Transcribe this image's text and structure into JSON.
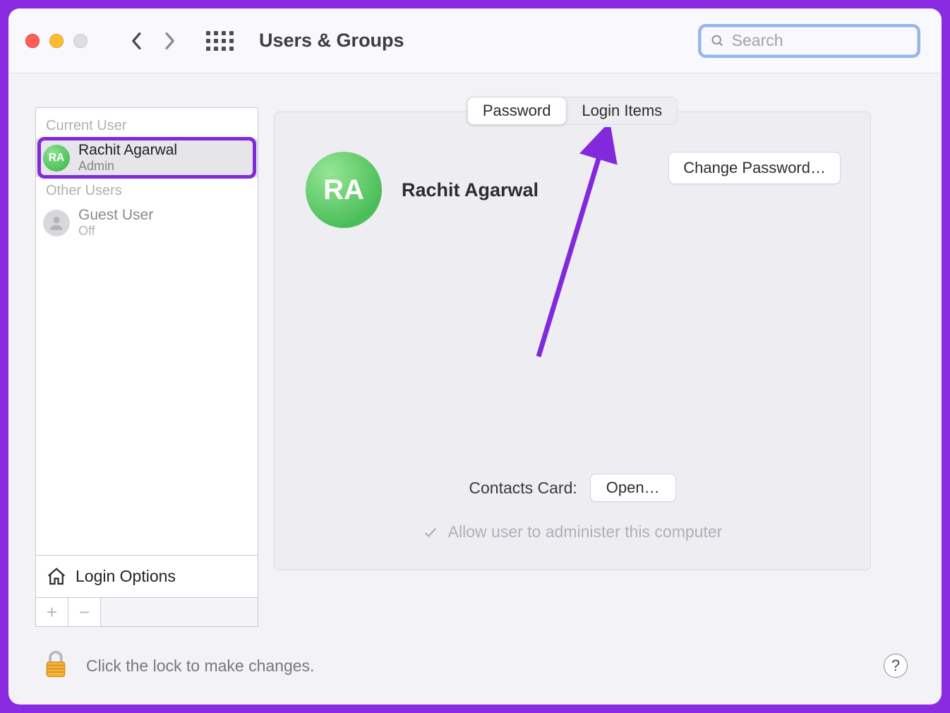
{
  "toolbar": {
    "title": "Users & Groups",
    "search_placeholder": "Search"
  },
  "sidebar": {
    "current_user_label": "Current User",
    "other_users_label": "Other Users",
    "current_user": {
      "initials": "RA",
      "name": "Rachit Agarwal",
      "role": "Admin"
    },
    "other_users": [
      {
        "name": "Guest User",
        "role": "Off"
      }
    ],
    "login_options_label": "Login Options"
  },
  "main": {
    "tabs": {
      "password": "Password",
      "login_items": "Login Items"
    },
    "avatar_initials": "RA",
    "profile_name": "Rachit Agarwal",
    "change_password_label": "Change Password…",
    "contacts_label": "Contacts Card:",
    "open_label": "Open…",
    "admin_checkbox_label": "Allow user to administer this computer"
  },
  "footer": {
    "lock_text": "Click the lock to make changes.",
    "help_label": "?"
  }
}
